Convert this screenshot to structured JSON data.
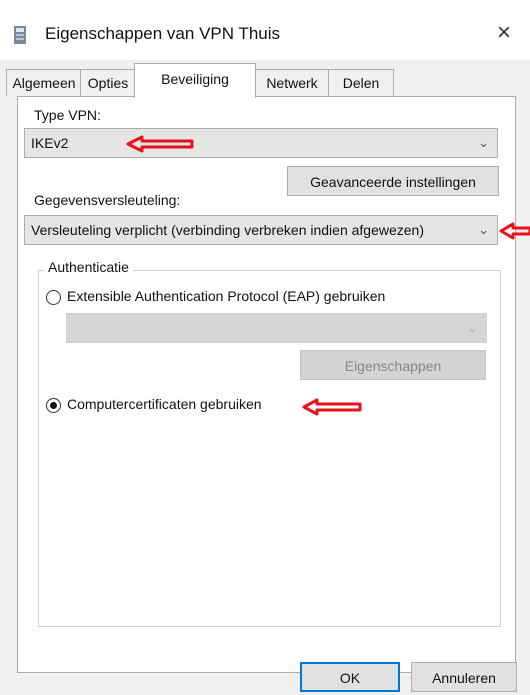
{
  "window": {
    "title": "Eigenschappen van VPN Thuis",
    "close_label": "×"
  },
  "tabs": [
    {
      "label": "Algemeen",
      "active": false
    },
    {
      "label": "Opties",
      "active": false
    },
    {
      "label": "Beveiliging",
      "active": true
    },
    {
      "label": "Netwerk",
      "active": false
    },
    {
      "label": "Delen",
      "active": false
    }
  ],
  "security": {
    "vpn_type_label": "Type VPN:",
    "vpn_type_value": "IKEv2",
    "advanced_button": "Geavanceerde instellingen",
    "encryption_label": "Gegevensversleuteling:",
    "encryption_value": "Versleuteling verplicht (verbinding verbreken indien afgewezen)",
    "auth_group_title": "Authenticatie",
    "eap_option_label": "Extensible Authentication Protocol (EAP) gebruiken",
    "eap_option_selected": false,
    "eap_properties_button": "Eigenschappen",
    "cert_option_label": "Computercertificaten gebruiken",
    "cert_option_selected": true
  },
  "footer": {
    "ok_label": "OK",
    "cancel_label": "Annuleren"
  },
  "colors": {
    "annotation_arrow": "#e8101a",
    "focus_border": "#0078d7"
  }
}
